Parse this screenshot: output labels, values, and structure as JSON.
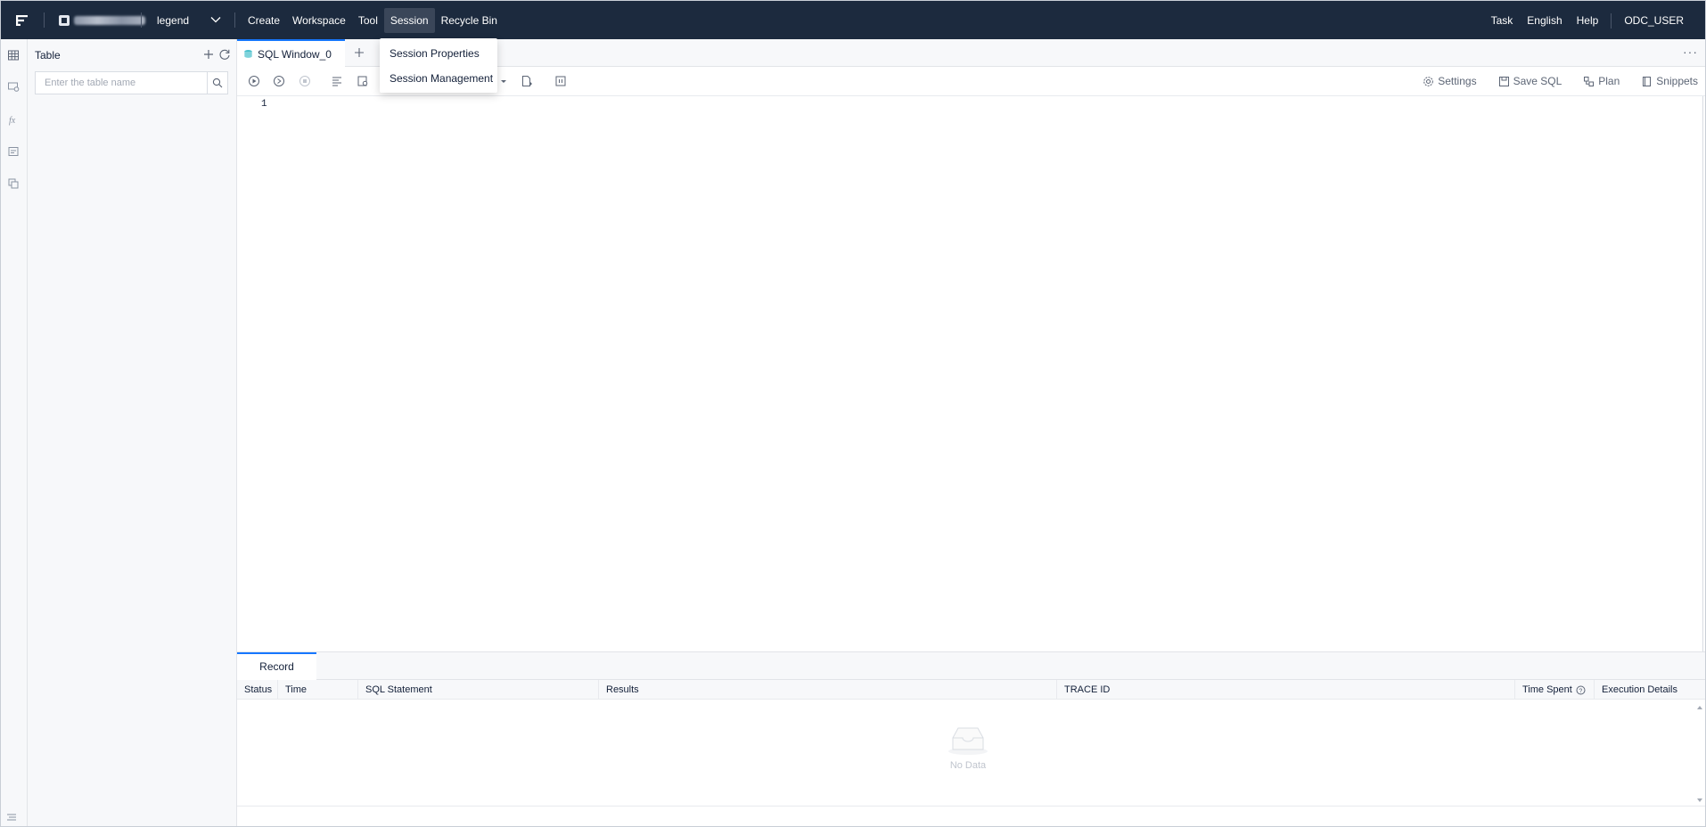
{
  "topbar": {
    "logo_icon": "odc-logo-icon",
    "connection_label": "mysql_2010",
    "database": "legend",
    "menu": [
      "Create",
      "Workspace",
      "Tool",
      "Session",
      "Recycle Bin"
    ],
    "active_menu": "Session",
    "right_menu": [
      "Task",
      "English",
      "Help"
    ],
    "user": "ODC_USER"
  },
  "dropdown": {
    "items": [
      "Session Properties",
      "Session Management"
    ]
  },
  "activity_bar": {
    "icons": [
      "table-icon",
      "view-icon",
      "function-icon",
      "procedure-icon",
      "sequence-icon"
    ]
  },
  "side_panel": {
    "title": "Table",
    "search_placeholder": "Enter the table name"
  },
  "tabs": {
    "active_tab": "SQL Window_0",
    "more": "···"
  },
  "toolbar": {
    "right": [
      "Settings",
      "Save SQL",
      "Plan",
      "Snippets"
    ]
  },
  "editor": {
    "line_numbers": [
      "1"
    ]
  },
  "bottom": {
    "tab": "Record",
    "columns": [
      "Status",
      "Time",
      "SQL Statement",
      "Results",
      "TRACE ID",
      "Time Spent",
      "Execution Details"
    ],
    "empty_text": "No Data"
  },
  "colors": {
    "topbar": "#1c2a3e",
    "accent": "#1677ff",
    "panel": "#f7f8fa"
  }
}
